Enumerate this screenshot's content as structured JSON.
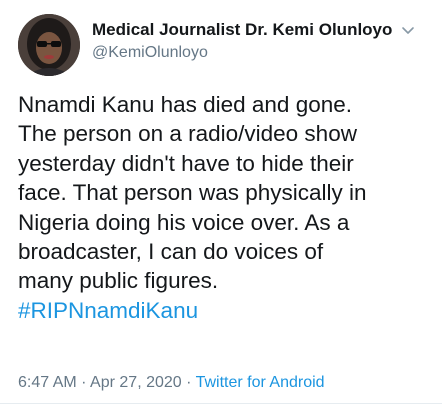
{
  "author": {
    "display_name": "Medical Journalist Dr. Kemi Olunloyo",
    "handle": "@KemiOlunloyo",
    "avatar_icon": "profile-photo"
  },
  "menu_icon": "chevron-down-icon",
  "tweet": {
    "lines": [
      "Nnamdi Kanu has died and gone.",
      "The person on a radio/video show",
      "yesterday didn't have to hide their",
      "face. That person was physically in",
      "Nigeria doing his voice over. As a",
      "broadcaster, I can do voices of",
      "many public figures."
    ],
    "hashtag": "#RIPNnamdiKanu"
  },
  "meta": {
    "time": "6:47 AM",
    "separator": " · ",
    "date": "Apr 27, 2020",
    "source": "Twitter for Android"
  },
  "colors": {
    "text": "#14171a",
    "secondary": "#657786",
    "link": "#1b95e0"
  }
}
